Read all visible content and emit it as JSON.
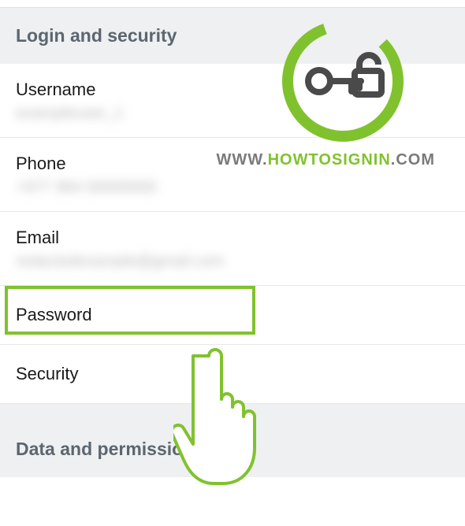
{
  "sections": {
    "login_security": {
      "header": "Login and security",
      "rows": {
        "username": {
          "label": "Username",
          "value": "exampleuser_1"
        },
        "phone": {
          "label": "Phone",
          "value": "+977 984 00000000"
        },
        "email": {
          "label": "Email",
          "value": "redactedexample@gmail.com"
        },
        "password": {
          "label": "Password"
        },
        "security": {
          "label": "Security"
        }
      }
    },
    "data_permissions": {
      "header": "Data and permissions"
    }
  },
  "watermark": {
    "prefix": "WWW.",
    "accent": "HOWTOSIGNIN",
    "suffix": ".COM"
  },
  "colors": {
    "accent_green": "#80c22e",
    "section_bg": "#eef0f2",
    "text_primary": "#1a1a1a",
    "text_muted": "#5c6670"
  }
}
